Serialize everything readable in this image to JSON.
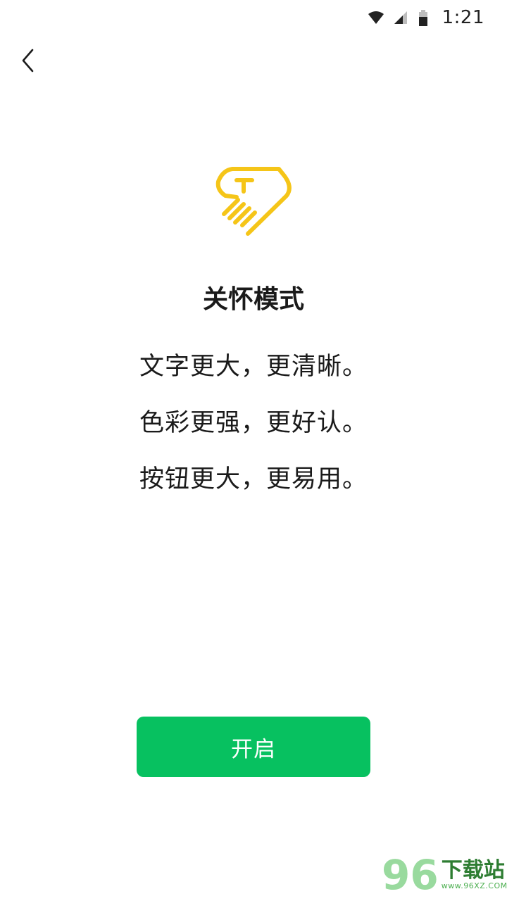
{
  "status_bar": {
    "time": "1:21",
    "icons": [
      "wifi-icon",
      "cellular-signal-icon",
      "battery-icon"
    ]
  },
  "nav": {
    "back_icon": "chevron-left-icon"
  },
  "logo": {
    "icon": "care-mode-heart-hand-icon",
    "color": "#f5c518"
  },
  "content": {
    "title": "关怀模式",
    "features": [
      "文字更大，更清晰。",
      "色彩更强，更好认。",
      "按钮更大，更易用。"
    ]
  },
  "action": {
    "open_label": "开启",
    "color": "#07c160"
  },
  "watermark": {
    "digits": "96",
    "title": "下载站",
    "url": "www.96XZ.COM"
  }
}
